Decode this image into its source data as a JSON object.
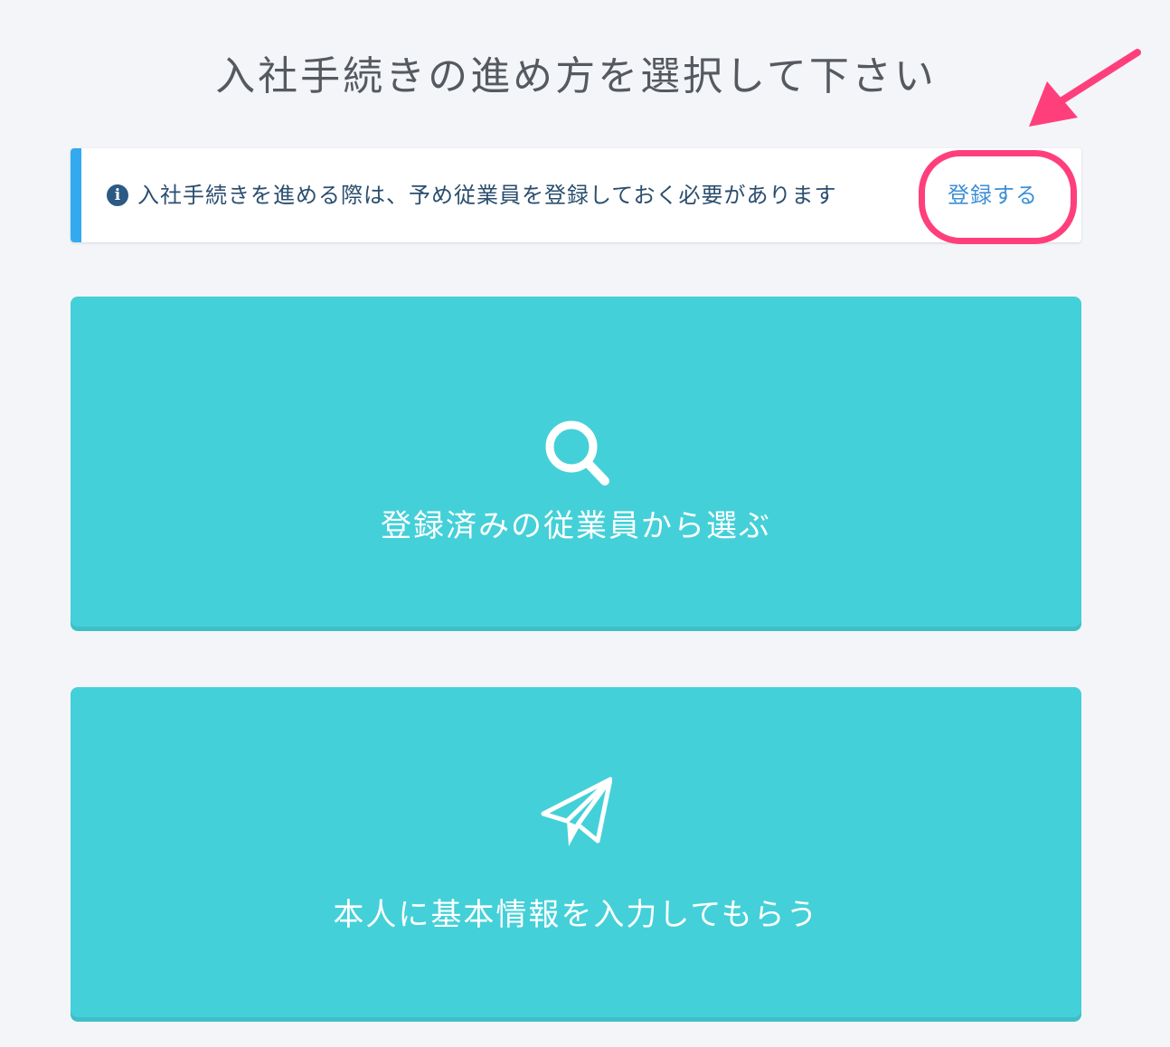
{
  "page": {
    "title": "入社手続きの進め方を選択して下さい"
  },
  "notice": {
    "text": "入社手続きを進める際は、予め従業員を登録しておく必要があります",
    "link_label": "登録する",
    "icon": "info-circle-icon"
  },
  "options": [
    {
      "label": "登録済みの従業員から選ぶ",
      "icon": "search-icon"
    },
    {
      "label": "本人に基本情報を入力してもらう",
      "icon": "paper-plane-icon"
    }
  ],
  "colors": {
    "background": "#f4f5f9",
    "card": "#44d0d8",
    "notice_accent": "#33aaf0",
    "link": "#3d8fd6",
    "highlight": "#ff3f7b"
  }
}
